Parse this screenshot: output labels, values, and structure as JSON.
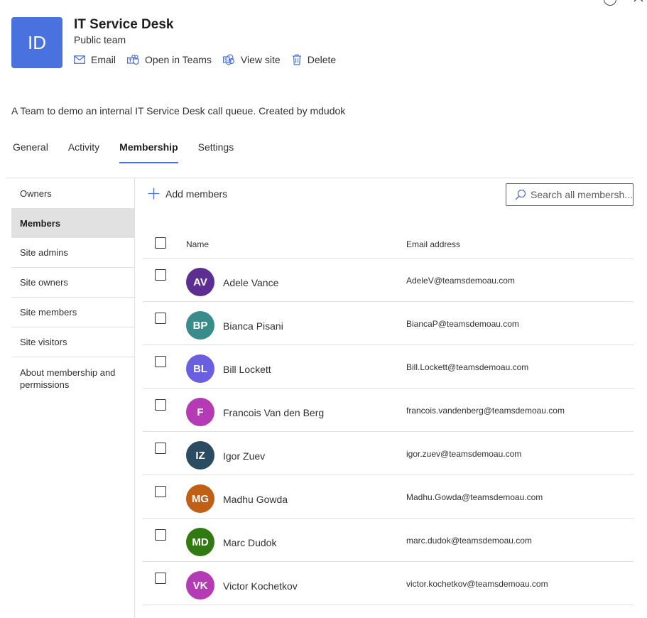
{
  "window": {
    "restore_icon": "circle-icon",
    "close_icon": "close-icon"
  },
  "header": {
    "tile_initials": "ID",
    "tile_color": "#4a72de",
    "title": "IT Service Desk",
    "subtitle": "Public team",
    "actions": [
      {
        "label": "Email",
        "icon": "mail-icon"
      },
      {
        "label": "Open in Teams",
        "icon": "teams-icon"
      },
      {
        "label": "View site",
        "icon": "sharepoint-icon"
      },
      {
        "label": "Delete",
        "icon": "trash-icon"
      }
    ]
  },
  "description": "A Team to demo an internal IT Service Desk call queue. Created by mdudok",
  "tabs": [
    {
      "label": "General",
      "active": false
    },
    {
      "label": "Activity",
      "active": false
    },
    {
      "label": "Membership",
      "active": true
    },
    {
      "label": "Settings",
      "active": false
    }
  ],
  "sidebar": {
    "items": [
      {
        "label": "Owners"
      },
      {
        "label": "Members",
        "active": true
      },
      {
        "label": "Site admins"
      },
      {
        "label": "Site owners"
      },
      {
        "label": "Site members"
      },
      {
        "label": "Site visitors"
      },
      {
        "label": "About membership and permissions"
      }
    ]
  },
  "toolbar": {
    "add_members_label": "Add members",
    "search_placeholder": "Search all membersh..."
  },
  "table": {
    "headers": {
      "name": "Name",
      "email": "Email address"
    },
    "rows": [
      {
        "initials": "AV",
        "color": "#5c2e91",
        "name": "Adele Vance",
        "email": "AdeleV@teamsdemoau.com"
      },
      {
        "initials": "BP",
        "color": "#3a8c8a",
        "name": "Bianca Pisani",
        "email": "BiancaP@teamsdemoau.com"
      },
      {
        "initials": "BL",
        "color": "#6a5fe0",
        "name": "Bill Lockett",
        "email": "Bill.Lockett@teamsdemoau.com"
      },
      {
        "initials": "F",
        "color": "#b43bb4",
        "name": "Francois Van den Berg",
        "email": "francois.vandenberg@teamsdemoau.com"
      },
      {
        "initials": "IZ",
        "color": "#2b4b62",
        "name": "Igor Zuev",
        "email": "igor.zuev@teamsdemoau.com"
      },
      {
        "initials": "MG",
        "color": "#c15f14",
        "name": "Madhu Gowda",
        "email": "Madhu.Gowda@teamsdemoau.com"
      },
      {
        "initials": "MD",
        "color": "#317a12",
        "name": "Marc Dudok",
        "email": "marc.dudok@teamsdemoau.com"
      },
      {
        "initials": "VK",
        "color": "#b43bb4",
        "name": "Victor Kochetkov",
        "email": "victor.kochetkov@teamsdemoau.com"
      }
    ]
  }
}
